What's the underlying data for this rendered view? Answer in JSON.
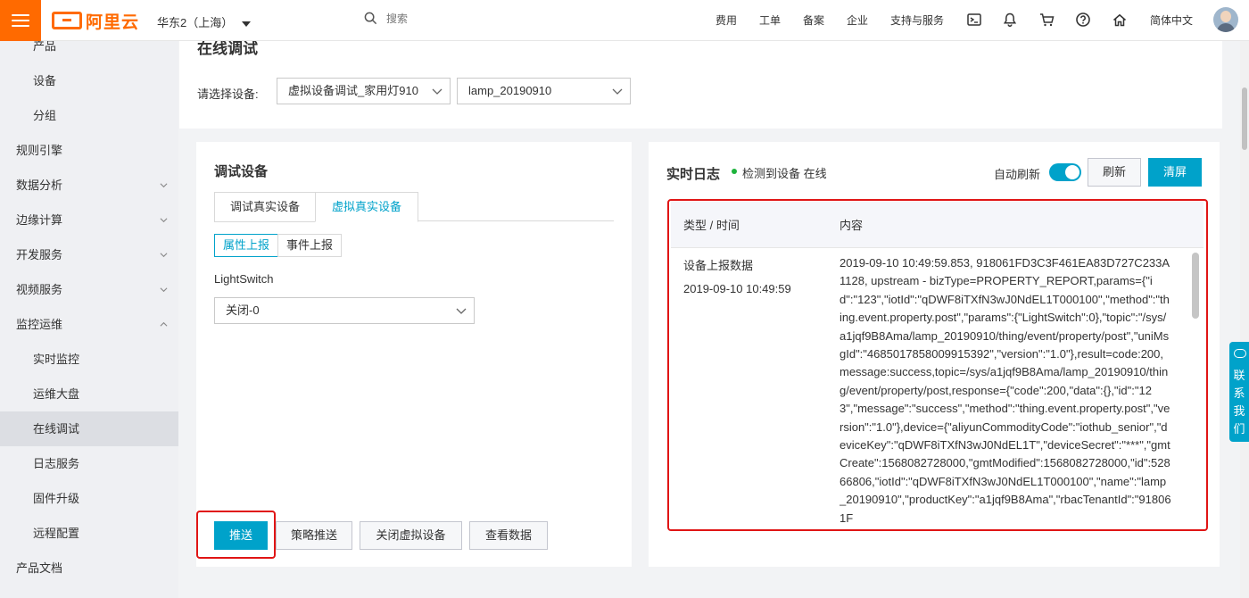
{
  "topbar": {
    "logo_text": "阿里云",
    "region": "华东2（上海）",
    "search_placeholder": "搜索",
    "nav": [
      "费用",
      "工单",
      "备案",
      "企业",
      "支持与服务"
    ],
    "language": "简体中文"
  },
  "sidebar": {
    "items": [
      {
        "label": "产品",
        "level": "sub"
      },
      {
        "label": "设备",
        "level": "sub"
      },
      {
        "label": "分组",
        "level": "sub"
      },
      {
        "label": "规则引擎",
        "level": "top"
      },
      {
        "label": "数据分析",
        "level": "top",
        "chevron": "down"
      },
      {
        "label": "边缘计算",
        "level": "top",
        "chevron": "down"
      },
      {
        "label": "开发服务",
        "level": "top",
        "chevron": "down"
      },
      {
        "label": "视频服务",
        "level": "top",
        "chevron": "down"
      },
      {
        "label": "监控运维",
        "level": "top",
        "chevron": "up"
      },
      {
        "label": "实时监控",
        "level": "sub"
      },
      {
        "label": "运维大盘",
        "level": "sub"
      },
      {
        "label": "在线调试",
        "level": "sub",
        "active": true
      },
      {
        "label": "日志服务",
        "level": "sub"
      },
      {
        "label": "固件升级",
        "level": "sub"
      },
      {
        "label": "远程配置",
        "level": "sub"
      },
      {
        "label": "产品文档",
        "level": "top"
      }
    ]
  },
  "page": {
    "title": "在线调试",
    "select_label": "请选择设备:",
    "product_select": "虚拟设备调试_家用灯910",
    "device_select": "lamp_20190910"
  },
  "debug_panel": {
    "title": "调试设备",
    "tabs": [
      "调试真实设备",
      "虚拟真实设备"
    ],
    "active_tab": "虚拟真实设备",
    "report_types": [
      "属性上报",
      "事件上报"
    ],
    "active_report_type": "属性上报",
    "property_label": "LightSwitch",
    "property_value": "关闭-0",
    "buttons": {
      "push": "推送",
      "strategy_push": "策略推送",
      "close_virtual": "关闭虚拟设备",
      "view_data": "查看数据"
    }
  },
  "log_panel": {
    "title": "实时日志",
    "status": "检测到设备 在线",
    "auto_refresh_label": "自动刷新",
    "auto_refresh_on": true,
    "refresh_button": "刷新",
    "clear_button": "清屏",
    "columns": [
      "类型 / 时间",
      "内容"
    ],
    "entries": [
      {
        "type": "设备上报数据",
        "time": "2019-09-10 10:49:59",
        "content": "2019-09-10 10:49:59.853, 918061FD3C3F461EA83D727C233A1128, upstream - bizType=PROPERTY_REPORT,params={\"id\":\"123\",\"iotId\":\"qDWF8iTXfN3wJ0NdEL1T000100\",\"method\":\"thing.event.property.post\",\"params\":{\"LightSwitch\":0},\"topic\":\"/sys/a1jqf9B8Ama/lamp_20190910/thing/event/property/post\",\"uniMsgId\":\"4685017858009915392\",\"version\":\"1.0\"},result=code:200,message:success,topic=/sys/a1jqf9B8Ama/lamp_20190910/thing/event/property/post,response={\"code\":200,\"data\":{},\"id\":\"123\",\"message\":\"success\",\"method\":\"thing.event.property.post\",\"version\":\"1.0\"},device={\"aliyunCommodityCode\":\"iothub_senior\",\"deviceKey\":\"qDWF8iTXfN3wJ0NdEL1T\",\"deviceSecret\":\"***\",\"gmtCreate\":1568082728000,\"gmtModified\":1568082728000,\"id\":52866806,\"iotId\":\"qDWF8iTXfN3wJ0NdEL1T000100\",\"name\":\"lamp_20190910\",\"productKey\":\"a1jqf9B8Ama\",\"rbacTenantId\":\"918061F"
      }
    ]
  },
  "float_contact": "联系我们",
  "colors": {
    "brand_orange": "#ff6a00",
    "accent_blue": "#00a2ca",
    "highlight_red": "#e01515",
    "online_green": "#1db33c"
  }
}
